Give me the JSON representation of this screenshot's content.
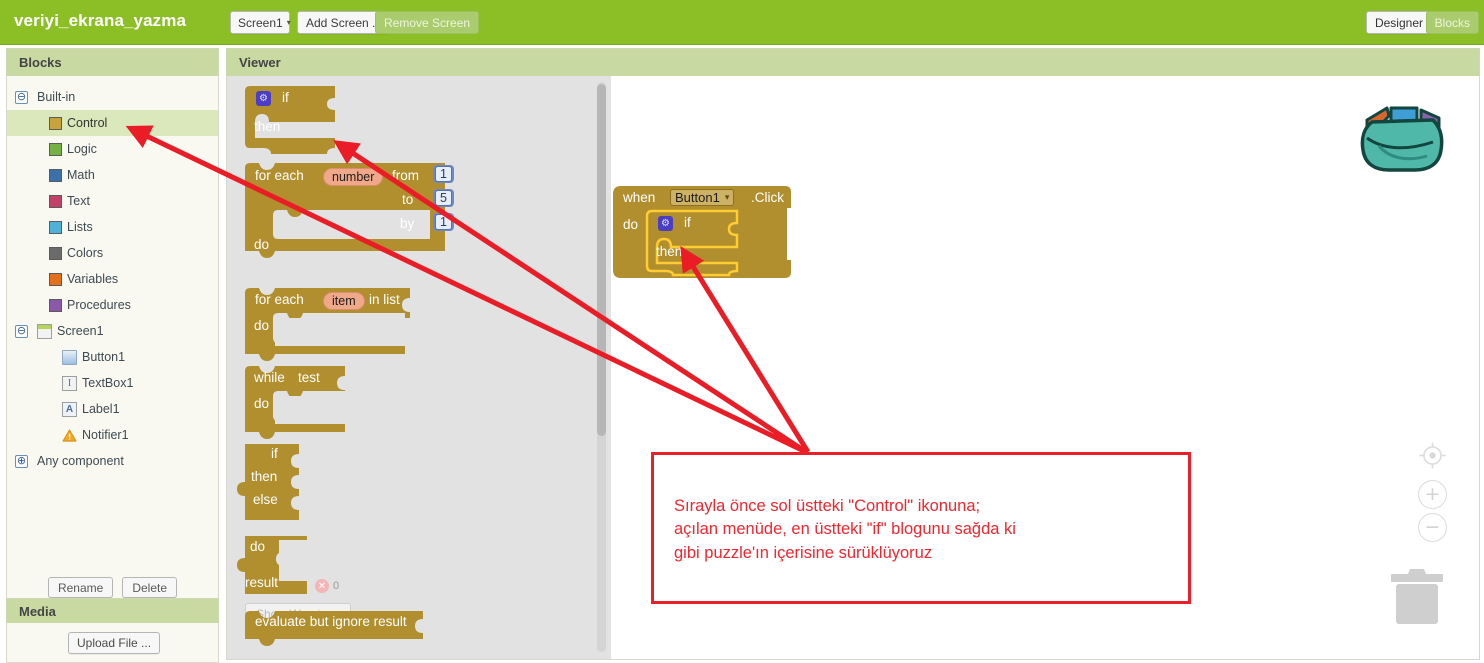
{
  "topbar": {
    "project_title": "veriyi_ekrana_yazma",
    "screen_select": "Screen1",
    "screen_select_caret": "▾",
    "add_screen": "Add Screen ...",
    "remove_screen": "Remove Screen",
    "designer": "Designer",
    "blocks": "Blocks",
    "bg_color": "#8cbf26"
  },
  "palette": {
    "header": "Blocks",
    "builtin": {
      "label": "Built-in",
      "expander": "⊖"
    },
    "builtin_items": [
      {
        "label": "Control",
        "color": "#c8a33c",
        "selected": true
      },
      {
        "label": "Logic",
        "color": "#77b045",
        "selected": false
      },
      {
        "label": "Math",
        "color": "#3d6fa8",
        "selected": false
      },
      {
        "label": "Text",
        "color": "#c2416a",
        "selected": false
      },
      {
        "label": "Lists",
        "color": "#4fb3d9",
        "selected": false
      },
      {
        "label": "Colors",
        "color": "#6b6b6b",
        "selected": false
      },
      {
        "label": "Variables",
        "color": "#e4701e",
        "selected": false
      },
      {
        "label": "Procedures",
        "color": "#8a5aa8",
        "selected": false
      }
    ],
    "screen_node": {
      "label": "Screen1",
      "expander": "⊖"
    },
    "components": [
      {
        "label": "Button1",
        "icon": "button-icon"
      },
      {
        "label": "TextBox1",
        "icon": "textbox-icon"
      },
      {
        "label": "Label1",
        "icon": "label-icon"
      },
      {
        "label": "Notifier1",
        "icon": "notifier-icon"
      }
    ],
    "any_component": {
      "label": "Any component",
      "expander": "⊕"
    },
    "rename": "Rename",
    "delete": "Delete"
  },
  "media": {
    "header": "Media",
    "upload": "Upload File ..."
  },
  "viewer": {
    "header": "Viewer",
    "flyout_blocks": [
      {
        "name": "if-then-block",
        "lines": [
          "if",
          "then"
        ]
      },
      {
        "name": "for-each-number-block",
        "label": "for each",
        "var": "number",
        "rows": [
          {
            "label": "from",
            "value": "1"
          },
          {
            "label": "to",
            "value": "5"
          },
          {
            "label": "by",
            "value": "1"
          }
        ],
        "do_label": "do"
      },
      {
        "name": "for-each-item-in-list-block",
        "label": "for each",
        "var": "item",
        "suffix": "in list",
        "do_label": "do"
      },
      {
        "name": "while-test-block",
        "label": "while",
        "test": "test",
        "do_label": "do"
      },
      {
        "name": "if-then-else-block",
        "lines": [
          "if",
          "then",
          "else"
        ]
      },
      {
        "name": "do-result-block",
        "lines": [
          "do",
          "result"
        ]
      },
      {
        "name": "evaluate-but-ignore-result-block",
        "label": "evaluate but ignore result"
      }
    ],
    "warnings": {
      "count": "0",
      "show_warnings_label": "Show Warnings"
    },
    "workspace_block": {
      "when": "when",
      "component": "Button1",
      "caret": "▾",
      "event": ".Click",
      "do": "do",
      "inner_if": "if",
      "inner_then": "then"
    },
    "controls": {
      "backpack": "backpack-icon",
      "center": "center-workspace-button",
      "zoom_in": "+",
      "zoom_out": "−",
      "trash": "trash-can"
    }
  },
  "annotation": {
    "text": "Sırayla önce sol üstteki \"Control\" ikonuna;\naçılan menüde, en üstteki \"if\" blogunu sağda ki\ngibi puzzle'ın içerisine sürüklüyoruz",
    "color": "#f0262e"
  }
}
